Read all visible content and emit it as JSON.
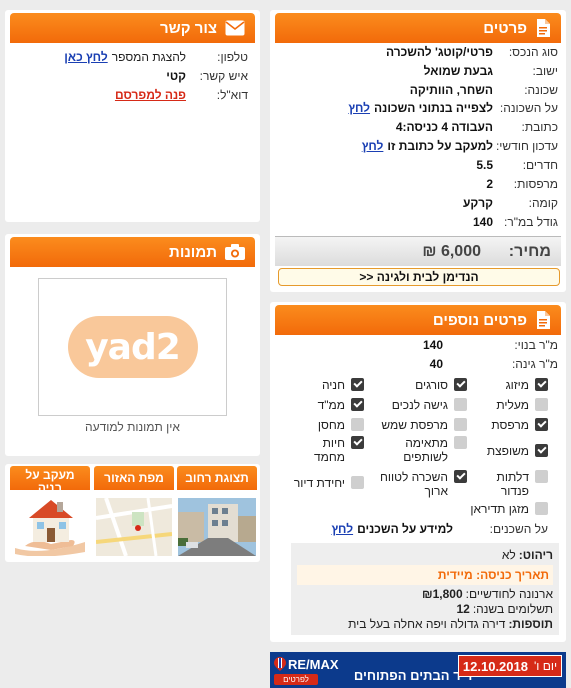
{
  "details": {
    "title": "פרטים",
    "rows": [
      {
        "label": "סוג הנכס:",
        "value": "פרטי/קוטג' להשכרה"
      },
      {
        "label": "ישוב:",
        "value": "גבעת שמואל"
      },
      {
        "label": "שכונה:",
        "value": "השחר, הוותיקה"
      },
      {
        "label": "על השכונה:",
        "value": "לצפייה בנתוני השכונה",
        "link": "לחץ"
      },
      {
        "label": "כתובת:",
        "value": "העבודה 4 כניסה:4"
      },
      {
        "label": "עדכון חודשי:",
        "value": "למעקב על כתובת זו",
        "link": "לחץ"
      },
      {
        "label": "חדרים:",
        "value": "5.5"
      },
      {
        "label": "מרפסות:",
        "value": "2"
      },
      {
        "label": "קומה:",
        "value": "קרקע"
      },
      {
        "label": "גודל במ\"ר:",
        "value": "140"
      }
    ],
    "price_label": "מחיר:",
    "price_value": "6,000 ₪",
    "promo_button": "הנדימן לבית ולגינה <<"
  },
  "more": {
    "title": "פרטים נוספים",
    "built_label": "מ\"ר בנוי:",
    "built_value": "140",
    "garden_label": "מ\"ר גינה:",
    "garden_value": "40",
    "features": [
      {
        "label": "מיזוג",
        "on": true
      },
      {
        "label": "סורגים",
        "on": true
      },
      {
        "label": "חניה",
        "on": true
      },
      {
        "label": "מעלית",
        "on": false
      },
      {
        "label": "גישה לנכים",
        "on": false
      },
      {
        "label": "ממ\"ד",
        "on": true
      },
      {
        "label": "מרפסת",
        "on": true
      },
      {
        "label": "מרפסת שמש",
        "on": false
      },
      {
        "label": "מחסן",
        "on": false
      },
      {
        "label": "משופצת",
        "on": true
      },
      {
        "label": "מתאימה לשותפים",
        "on": false
      },
      {
        "label": "חיות מחמד",
        "on": true
      },
      {
        "label": "דלתות פנדור",
        "on": false
      },
      {
        "label": "השכרה לטווח ארוך",
        "on": true
      },
      {
        "label": "יחידת דיור",
        "on": false
      },
      {
        "label": "מזגן תדיראן",
        "on": false
      }
    ],
    "neighbors_label": "על השכנים:",
    "neighbors_text": "למידע על השכנים",
    "neighbors_link": "לחץ",
    "furniture_label": "ריהוט:",
    "furniture_value": "לא",
    "entry_text": "תאריך כניסה: מיידית",
    "arnona_label": "ארנונה לחודשיים:",
    "arnona_value": "₪1,800",
    "payments_label": "תשלומים בשנה:",
    "payments_value": "12",
    "extras_label": "תוספות:",
    "extras_value": "דירה גדולה ויפה אחלה בעל בית"
  },
  "contact": {
    "title": "צור קשר",
    "phone_label": "טלפון:",
    "phone_text": "להצגת המספר",
    "phone_link": "לחץ כאן",
    "person_label": "איש קשר:",
    "person_value": "קטי",
    "email_label": "דוא\"ל:",
    "email_link": "פנה למפרסם"
  },
  "photos": {
    "title": "תמונות",
    "logo_text": "yad2",
    "empty_text": "אין תמונות למודעה"
  },
  "tiles": [
    {
      "label": "תצוגת רחוב"
    },
    {
      "label": "מפת האזור"
    },
    {
      "label": "מעקב על בניה"
    }
  ],
  "banner": {
    "brand": "RE/MAX",
    "sub": "לפרטים",
    "date": "12.10.2018",
    "day": "יום ו'",
    "headline": "יריד הבתים הפתוחים"
  },
  "colors": {
    "accent": "#f26a0a",
    "link": "#1a3fb3",
    "banner": "#0c3a8c"
  }
}
